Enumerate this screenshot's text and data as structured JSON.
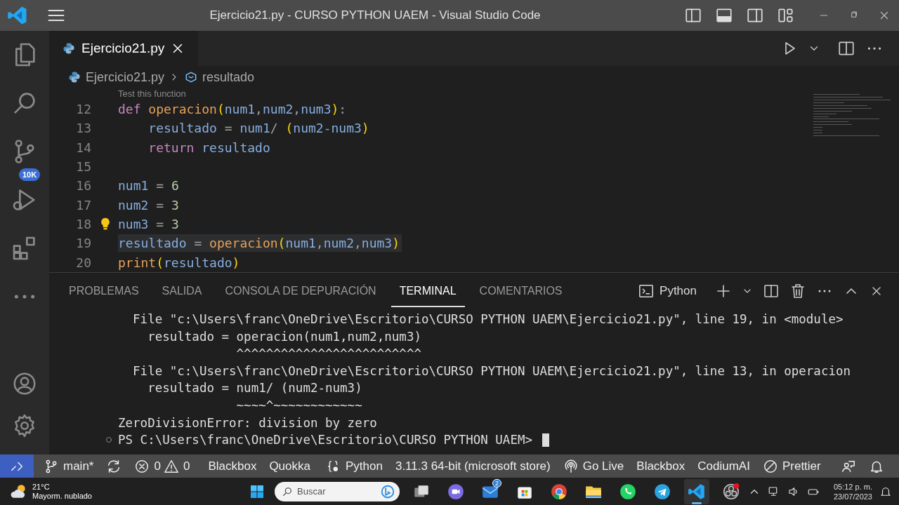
{
  "window": {
    "title": "Ejercicio21.py - CURSO PYTHON UAEM - Visual Studio Code"
  },
  "activity_bar": {
    "items": [
      {
        "kind": "explorer"
      },
      {
        "kind": "search"
      },
      {
        "kind": "source-control",
        "badge": "10K"
      },
      {
        "kind": "run"
      },
      {
        "kind": "extensions"
      },
      {
        "kind": "more"
      }
    ],
    "bottom": [
      {
        "kind": "account"
      },
      {
        "kind": "settings"
      }
    ]
  },
  "tabs": [
    {
      "label": "Ejercicio21.py",
      "selected": true
    }
  ],
  "breadcrumb": [
    "Ejercicio21.py",
    "resultado"
  ],
  "editor": {
    "codelens": "Test this function",
    "lines": [
      {
        "number": "12",
        "highlighted": false,
        "tokens": [
          {
            "text": "def ",
            "kind": "kw"
          },
          {
            "text": "operacion",
            "kind": "fn"
          },
          {
            "text": "(",
            "kind": "paren"
          },
          {
            "text": "num1",
            "kind": "var"
          },
          {
            "text": ",",
            "kind": "op"
          },
          {
            "text": "num2",
            "kind": "var"
          },
          {
            "text": ",",
            "kind": "op"
          },
          {
            "text": "num3",
            "kind": "var"
          },
          {
            "text": ")",
            "kind": "paren"
          },
          {
            "text": ":",
            "kind": "op"
          }
        ]
      },
      {
        "number": "13",
        "highlighted": false,
        "tokens": [
          {
            "text": "    resultado",
            "kind": "var"
          },
          {
            "text": " = ",
            "kind": "op"
          },
          {
            "text": "num1",
            "kind": "var"
          },
          {
            "text": "/ ",
            "kind": "op"
          },
          {
            "text": "(",
            "kind": "paren"
          },
          {
            "text": "num2",
            "kind": "var"
          },
          {
            "text": "-",
            "kind": "op"
          },
          {
            "text": "num3",
            "kind": "var"
          },
          {
            "text": ")",
            "kind": "paren"
          }
        ]
      },
      {
        "number": "14",
        "highlighted": false,
        "tokens": [
          {
            "text": "    return ",
            "kind": "kw"
          },
          {
            "text": "resultado",
            "kind": "var"
          }
        ]
      },
      {
        "number": "15",
        "highlighted": false
      },
      {
        "number": "16",
        "highlighted": false,
        "tokens": [
          {
            "text": "num1",
            "kind": "var"
          },
          {
            "text": " = ",
            "kind": "op"
          },
          {
            "text": "6",
            "kind": "num"
          }
        ]
      },
      {
        "number": "17",
        "highlighted": false,
        "tokens": [
          {
            "text": "num2",
            "kind": "var"
          },
          {
            "text": " = ",
            "kind": "op"
          },
          {
            "text": "3",
            "kind": "num"
          }
        ]
      },
      {
        "number": "18",
        "highlighted": false,
        "lightbulb": true,
        "tokens": [
          {
            "text": "num3",
            "kind": "var"
          },
          {
            "text": " = ",
            "kind": "op"
          },
          {
            "text": "3",
            "kind": "num"
          }
        ]
      },
      {
        "number": "19",
        "highlighted": true,
        "tokens": [
          {
            "text": "resultado",
            "kind": "var"
          },
          {
            "text": " = ",
            "kind": "op"
          },
          {
            "text": "operacion",
            "kind": "fn"
          },
          {
            "text": "(",
            "kind": "paren"
          },
          {
            "text": "num1",
            "kind": "var"
          },
          {
            "text": ",",
            "kind": "op"
          },
          {
            "text": "num2",
            "kind": "var"
          },
          {
            "text": ",",
            "kind": "op"
          },
          {
            "text": "num3",
            "kind": "var"
          },
          {
            "text": ")",
            "kind": "paren"
          }
        ]
      },
      {
        "number": "20",
        "highlighted": false,
        "tokens": [
          {
            "text": "print",
            "kind": "fn"
          },
          {
            "text": "(",
            "kind": "paren"
          },
          {
            "text": "resultado",
            "kind": "var"
          },
          {
            "text": ")",
            "kind": "paren"
          }
        ]
      }
    ]
  },
  "panel": {
    "tabs": [
      {
        "label": "PROBLEMAS",
        "selected": false
      },
      {
        "label": "SALIDA",
        "selected": false
      },
      {
        "label": "CONSOLA DE DEPURACIÓN",
        "selected": false
      },
      {
        "label": "TERMINAL",
        "selected": true
      },
      {
        "label": "COMENTARIOS",
        "selected": false
      }
    ],
    "terminal_name": "Python",
    "terminal_lines": [
      "  File \"c:\\Users\\franc\\OneDrive\\Escritorio\\CURSO PYTHON UAEM\\Ejercicio21.py\", line 19, in <module>",
      "    resultado = operacion(num1,num2,num3)",
      "                ^^^^^^^^^^^^^^^^^^^^^^^^^",
      "  File \"c:\\Users\\franc\\OneDrive\\Escritorio\\CURSO PYTHON UAEM\\Ejercicio21.py\", line 13, in operacion",
      "    resultado = num1/ (num2-num3)",
      "                ~~~~^~~~~~~~~~~~~",
      "ZeroDivisionError: division by zero"
    ],
    "prompt": "PS C:\\Users\\franc\\OneDrive\\Escritorio\\CURSO PYTHON UAEM>"
  },
  "status_bar": {
    "items": [
      {
        "kind": "remote"
      },
      {
        "kind": "branch",
        "text": "main*"
      },
      {
        "kind": "sync"
      },
      {
        "kind": "errors",
        "text": "0"
      },
      {
        "kind": "warnings",
        "text": "0"
      },
      {
        "kind": "text",
        "text": "Blackbox"
      },
      {
        "kind": "text",
        "text": "Quokka"
      },
      {
        "kind": "language",
        "text": "Python"
      },
      {
        "kind": "text",
        "text": "3.11.3 64-bit (microsoft store)"
      },
      {
        "kind": "golive",
        "text": "Go Live"
      },
      {
        "kind": "text",
        "text": "Blackbox"
      },
      {
        "kind": "text",
        "text": "CodiumAI"
      },
      {
        "kind": "prettier",
        "text": "Prettier"
      },
      {
        "kind": "feedback"
      },
      {
        "kind": "bell"
      }
    ]
  },
  "taskbar": {
    "weather": {
      "temp": "21°C",
      "desc": "Mayorm. nublado"
    },
    "search": {
      "placeholder": "Buscar"
    },
    "apps": [
      {
        "kind": "task-view",
        "selected": false
      },
      {
        "kind": "chat",
        "selected": false
      },
      {
        "kind": "mail",
        "badge": "2",
        "selected": false
      },
      {
        "kind": "store",
        "selected": false
      },
      {
        "kind": "browser",
        "selected": false
      },
      {
        "kind": "folder",
        "selected": false
      },
      {
        "kind": "whatsapp",
        "selected": false
      },
      {
        "kind": "telegram",
        "selected": false
      },
      {
        "kind": "vscode",
        "selected": true
      },
      {
        "kind": "obs",
        "selected": false
      }
    ],
    "time": "05:12 p. m.",
    "date": "23/07/2023"
  }
}
